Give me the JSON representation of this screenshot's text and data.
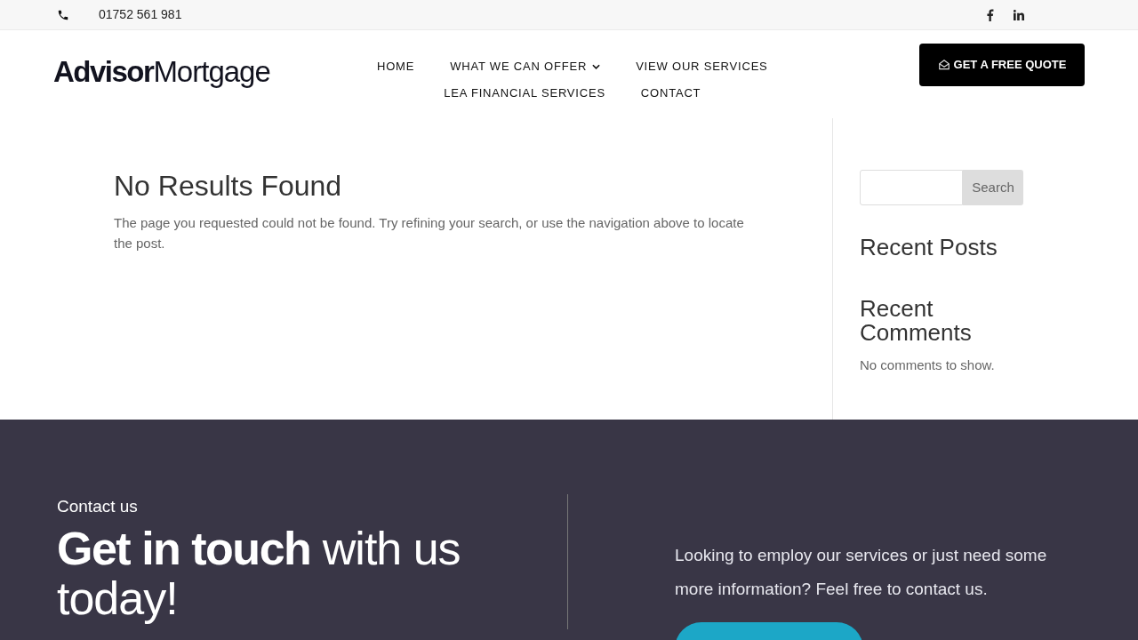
{
  "top_bar": {
    "phone": "01752 561 981",
    "social": [
      {
        "kind": "facebook"
      },
      {
        "kind": "linkedin"
      }
    ]
  },
  "header": {
    "logo": "**Advisor**Mortgage",
    "nav_rows": [
      [
        {
          "label": "HOME",
          "has_dropdown": false
        },
        {
          "label": "WHAT WE CAN OFFER",
          "has_dropdown": true
        },
        {
          "label": "VIEW OUR SERVICES",
          "has_dropdown": false
        }
      ],
      [
        {
          "label": "LEA FINANCIAL SERVICES",
          "has_dropdown": false
        },
        {
          "label": "CONTACT",
          "has_dropdown": false
        }
      ]
    ],
    "quote_button": "GET A FREE QUOTE"
  },
  "main": {
    "title": "No Results Found",
    "message": "The page you requested could not be found. Try refining your search, or use the navigation above to locate the post."
  },
  "sidebar": {
    "search_button": "Search",
    "recent_posts_title": "Recent Posts",
    "recent_comments_title": "Recent Comments",
    "no_comments": "No comments to show."
  },
  "footer": {
    "eyebrow": "Contact us",
    "heading": "**Get in touch** with us today!",
    "text": "Looking to employ our services or just need some more information? Feel free to contact us.",
    "cta": {
      "kind": "pill"
    }
  }
}
